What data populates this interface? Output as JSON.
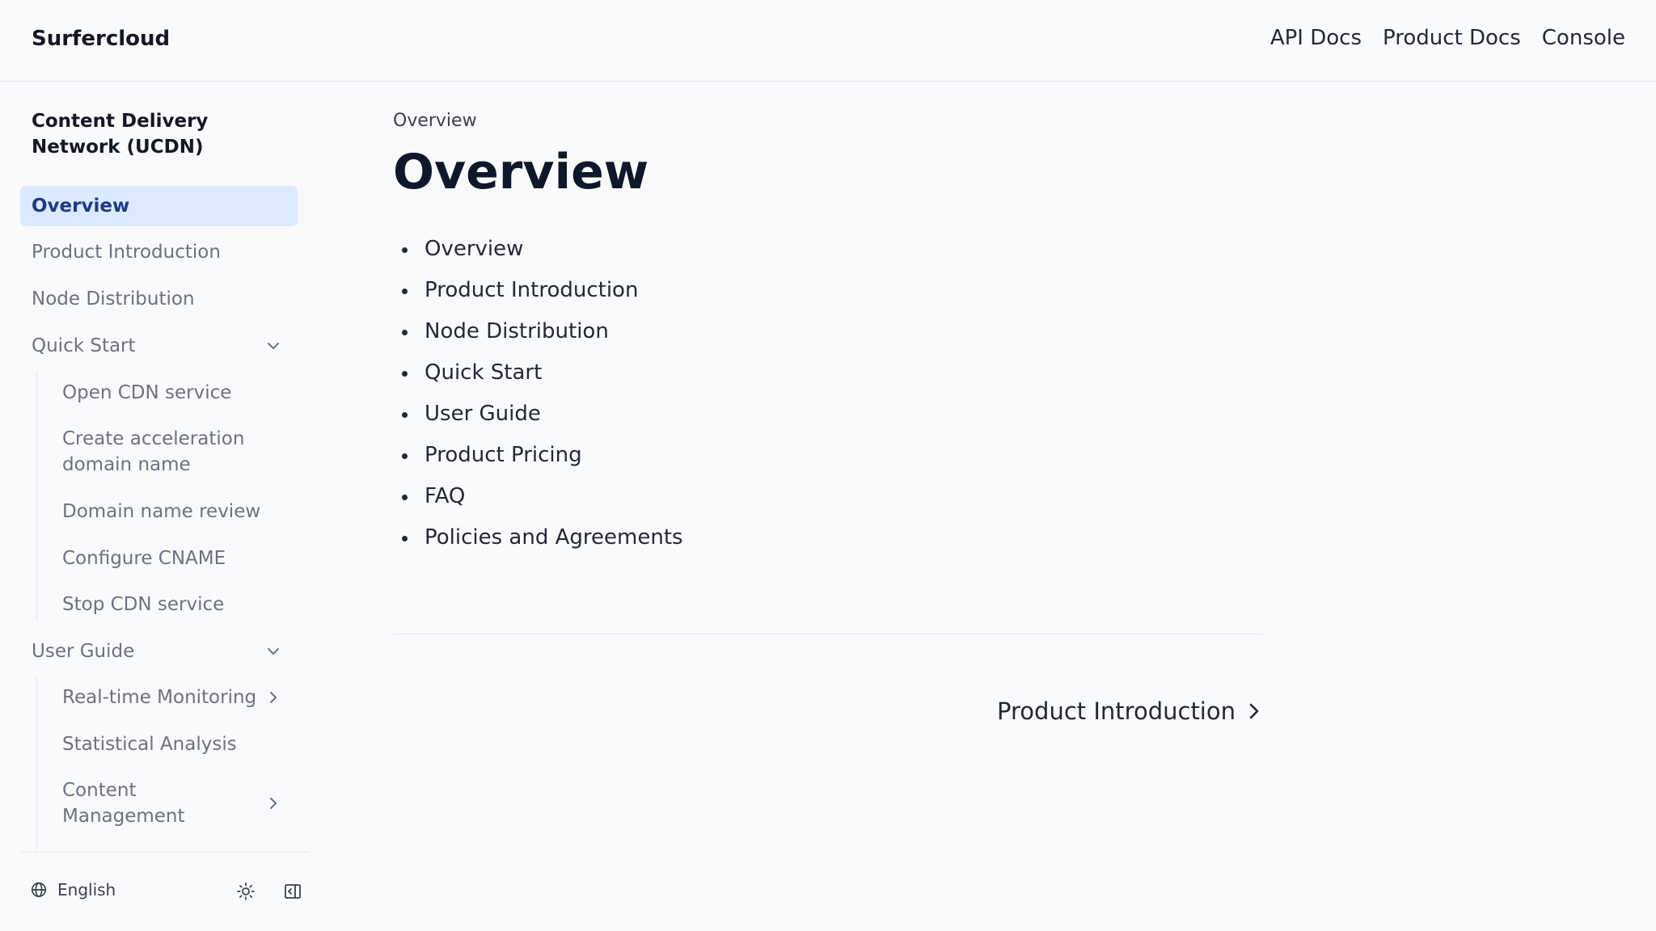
{
  "header": {
    "brand": "Surfercloud",
    "nav": [
      "API Docs",
      "Product Docs",
      "Console"
    ]
  },
  "sidebar": {
    "title": "Content Delivery Network (UCDN)",
    "items": {
      "overview": "Overview",
      "product_introduction": "Product Introduction",
      "node_distribution": "Node Distribution",
      "quick_start": "Quick Start",
      "user_guide": "User Guide"
    },
    "quick_start_children": [
      "Open CDN service",
      "Create acceleration domain name",
      "Domain name review",
      "Configure CNAME",
      "Stop CDN service"
    ],
    "user_guide_children": [
      "Real-time Monitoring",
      "Statistical Analysis",
      "Content Management"
    ],
    "footer": {
      "language": "English"
    }
  },
  "main": {
    "breadcrumb": "Overview",
    "title": "Overview",
    "toc": [
      "Overview",
      "Product Introduction",
      "Node Distribution",
      "Quick Start",
      "User Guide",
      "Product Pricing",
      "FAQ",
      "Policies and Agreements"
    ],
    "next_link": "Product Introduction"
  },
  "colors": {
    "active_bg": "#dbeafe",
    "active_text": "#1e3a8a",
    "background": "#f9fafb"
  }
}
